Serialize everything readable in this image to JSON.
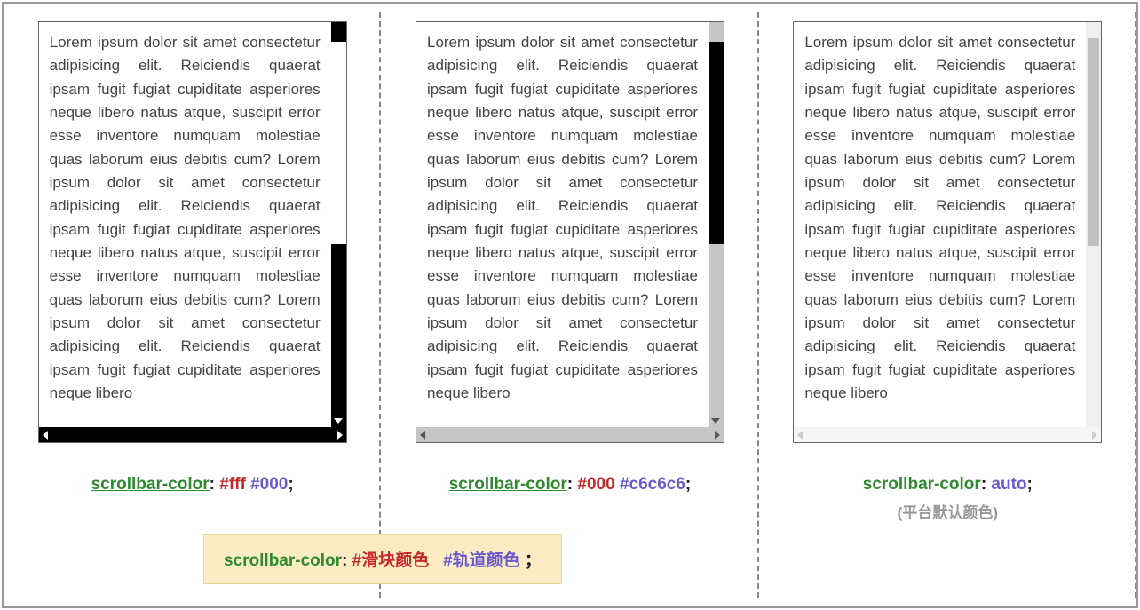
{
  "lorem": "Lorem ipsum dolor sit amet consectetur adipisicing elit. Reiciendis quaerat ipsam fugit fugiat cupiditate asperiores neque libero natus atque, suscipit error esse inventore numquam molestiae quas laborum eius debitis cum? Lorem ipsum dolor sit amet consectetur adipisicing elit. Reiciendis quaerat ipsam fugit fugiat cupiditate asperiores neque libero natus atque, suscipit error esse inventore numquam molestiae quas laborum eius debitis cum? Lorem ipsum dolor sit amet consectetur adipisicing elit. Reiciendis quaerat ipsam fugit fugiat cupiditate asperiores neque libero",
  "captions": {
    "c1": {
      "prop": "scrollbar-color",
      "colon": ": ",
      "thumb": "#fff",
      "space": " ",
      "track": "#000",
      "semi": ";"
    },
    "c2": {
      "prop": "scrollbar-color",
      "colon": ": ",
      "thumb": "#000",
      "space": " ",
      "track": "#c6c6c6",
      "semi": ";"
    },
    "c3": {
      "prop": "scrollbar-color",
      "colon": ": ",
      "val": "auto",
      "semi": ";",
      "sub": "(平台默认颜色)"
    }
  },
  "formula": {
    "prop": "scrollbar-color",
    "colon": ": ",
    "thumb": "#滑块颜色",
    "gap": "   ",
    "track": "#轨道颜色",
    "tail": " ；"
  }
}
